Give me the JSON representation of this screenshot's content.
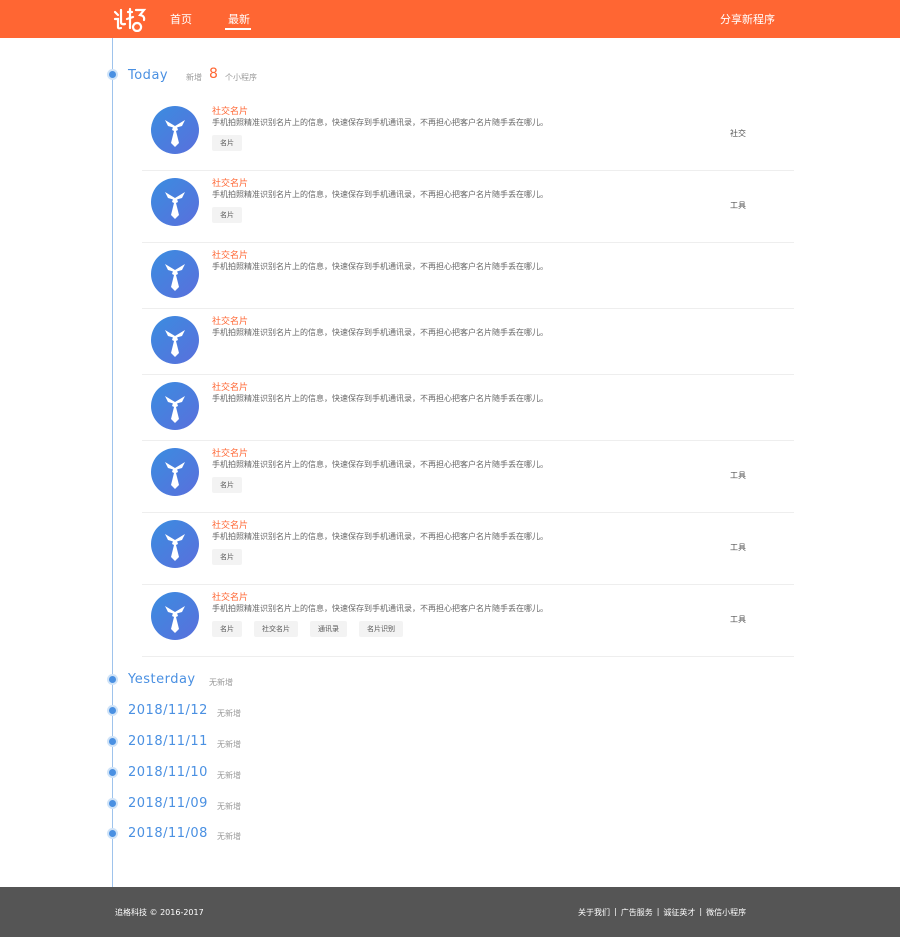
{
  "header": {
    "logo_alt": "logo-mark",
    "nav": [
      {
        "label": "首页"
      },
      {
        "label": "最新"
      }
    ],
    "share_label": "分享新程序",
    "bg_color": "#ff6633"
  },
  "today": {
    "label": "Today",
    "prefix": "新增",
    "count": "8",
    "suffix": "个小程序"
  },
  "items": [
    {
      "title": "社交名片",
      "desc": "手机拍照精准识别名片上的信息，快速保存到手机通讯录，不再担心把客户名片随手丢在哪儿。",
      "tags": [
        "名片"
      ],
      "category": "社交"
    },
    {
      "title": "社交名片",
      "desc": "手机拍照精准识别名片上的信息，快速保存到手机通讯录，不再担心把客户名片随手丢在哪儿。",
      "tags": [
        "名片"
      ],
      "category": "工具"
    },
    {
      "title": "社交名片",
      "desc": "手机拍照精准识别名片上的信息，快速保存到手机通讯录，不再担心把客户名片随手丢在哪儿。",
      "tags": [],
      "category": ""
    },
    {
      "title": "社交名片",
      "desc": "手机拍照精准识别名片上的信息，快速保存到手机通讯录，不再担心把客户名片随手丢在哪儿。",
      "tags": [],
      "category": ""
    },
    {
      "title": "社交名片",
      "desc": "手机拍照精准识别名片上的信息，快速保存到手机通讯录，不再担心把客户名片随手丢在哪儿。",
      "tags": [],
      "category": ""
    },
    {
      "title": "社交名片",
      "desc": "手机拍照精准识别名片上的信息，快速保存到手机通讯录，不再担心把客户名片随手丢在哪儿。",
      "tags": [
        "名片"
      ],
      "category": "工具"
    },
    {
      "title": "社交名片",
      "desc": "手机拍照精准识别名片上的信息，快速保存到手机通讯录，不再担心把客户名片随手丢在哪儿。",
      "tags": [
        "名片"
      ],
      "category": "工具"
    },
    {
      "title": "社交名片",
      "desc": "手机拍照精准识别名片上的信息，快速保存到手机通讯录，不再担心把客户名片随手丢在哪儿。",
      "tags": [
        "名片",
        "社交名片",
        "通讯录",
        "名片识别"
      ],
      "category": "工具"
    }
  ],
  "days": [
    {
      "label": "Yesterday",
      "note": "无新增"
    },
    {
      "label": "2018/11/12",
      "note": "无新增"
    },
    {
      "label": "2018/11/11",
      "note": "无新增"
    },
    {
      "label": "2018/11/10",
      "note": "无新增"
    },
    {
      "label": "2018/11/09",
      "note": "无新增"
    },
    {
      "label": "2018/11/08",
      "note": "无新增"
    }
  ],
  "footer": {
    "copyright": "追格科技 © 2016-2017",
    "links": [
      "关于我们",
      "广告服务",
      "诚征英才",
      "微信小程序"
    ],
    "separator": "|",
    "bg_color": "#555555"
  },
  "colors": {
    "accent": "#ff6633",
    "timeline": "#4a90e2"
  },
  "icons": {
    "avatar": "necktie-icon"
  }
}
